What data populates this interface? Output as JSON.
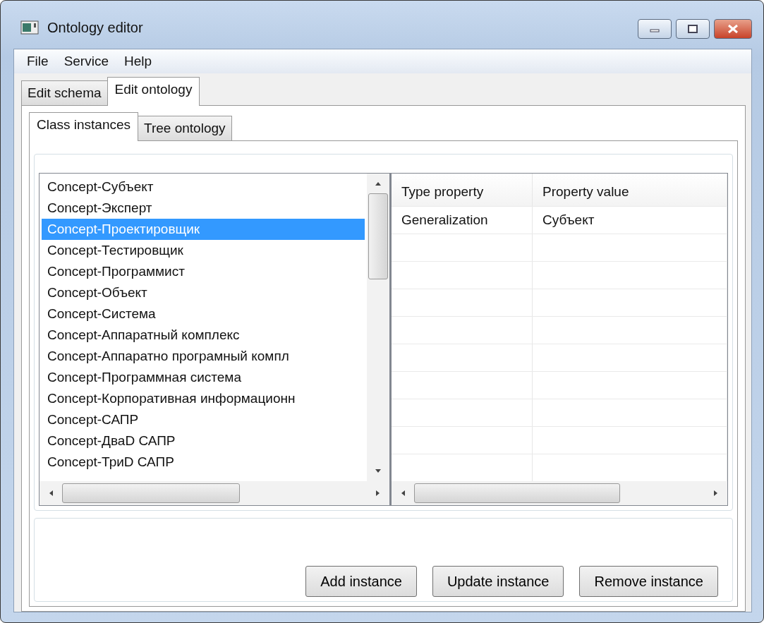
{
  "window": {
    "title": "Ontology editor"
  },
  "menu": [
    "File",
    "Service",
    "Help"
  ],
  "tabs": [
    {
      "label": "Edit schema",
      "selected": false
    },
    {
      "label": "Edit ontology",
      "selected": true
    }
  ],
  "subtabs": [
    {
      "label": "Class instances",
      "selected": true
    },
    {
      "label": "Tree ontology",
      "selected": false
    }
  ],
  "instances": [
    {
      "label": "Concept-Субъект",
      "selected": false
    },
    {
      "label": "Concept-Эксперт",
      "selected": false
    },
    {
      "label": "Concept-Проектировщик",
      "selected": true
    },
    {
      "label": "Concept-Тестировщик",
      "selected": false
    },
    {
      "label": "Concept-Программист",
      "selected": false
    },
    {
      "label": "Concept-Объект",
      "selected": false
    },
    {
      "label": "Concept-Система",
      "selected": false
    },
    {
      "label": "Concept-Аппаратный комплекс",
      "selected": false
    },
    {
      "label": "Concept-Аппаратно програмный компл",
      "selected": false
    },
    {
      "label": "Concept-Программная система",
      "selected": false
    },
    {
      "label": "Concept-Корпоративная информационн",
      "selected": false
    },
    {
      "label": "Concept-САПР",
      "selected": false
    },
    {
      "label": "Concept-ДваD САПР",
      "selected": false
    },
    {
      "label": "Concept-ТриD САПР",
      "selected": false
    }
  ],
  "properties": {
    "columns": [
      "Type property",
      "Property value"
    ],
    "rows": [
      [
        "Generalization",
        "Субъект"
      ]
    ]
  },
  "buttons": [
    "Add instance",
    "Update instance",
    "Remove instance"
  ]
}
